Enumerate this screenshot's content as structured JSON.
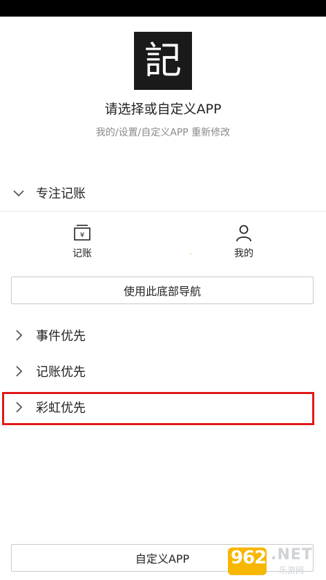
{
  "header": {
    "logo_char": "記",
    "title": "请选择或自定义APP",
    "subtitle": "我的/设置/自定义APP 重新修改"
  },
  "sections": {
    "focus": {
      "label": "专注记账",
      "expanded": true
    },
    "event": {
      "label": "事件优先",
      "expanded": false
    },
    "bookkeeping": {
      "label": "记账优先",
      "expanded": false
    },
    "rainbow": {
      "label": "彩虹优先",
      "expanded": false,
      "highlighted": true
    }
  },
  "nav_preview": {
    "items": [
      {
        "label": "记账",
        "icon": "bookkeeping-icon"
      },
      {
        "label": "我的",
        "icon": "person-icon"
      }
    ],
    "use_button": "使用此底部导航"
  },
  "footer": {
    "custom_button": "自定义APP"
  },
  "watermark": {
    "brand": "962",
    "domain": ".NET",
    "cn": "乐游网"
  },
  "colors": {
    "highlight": "#e01818",
    "logo_bg": "#1a1a1a",
    "status_bar": "#000000",
    "watermark": "#f7b600"
  }
}
